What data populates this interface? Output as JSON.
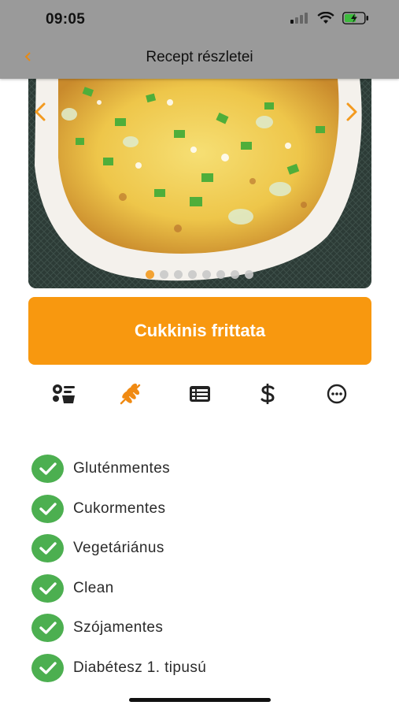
{
  "status_bar": {
    "time": "09:05"
  },
  "header": {
    "title": "Recept részletei"
  },
  "carousel": {
    "total_images": 8,
    "active_index": 0
  },
  "recipe": {
    "title": "Cukkinis frittata"
  },
  "tabs": [
    {
      "icon": "ingredients-scale-icon",
      "active": false
    },
    {
      "icon": "wheat-icon",
      "active": true
    },
    {
      "icon": "list-table-icon",
      "active": false
    },
    {
      "icon": "dollar-icon",
      "active": false
    },
    {
      "icon": "more-circle-icon",
      "active": false
    }
  ],
  "diet_tags": [
    {
      "label": "Gluténmentes"
    },
    {
      "label": "Cukormentes"
    },
    {
      "label": "Vegetáriánus"
    },
    {
      "label": "Clean"
    },
    {
      "label": "Szójamentes"
    },
    {
      "label": "Diabétesz 1. tipusú"
    }
  ],
  "colors": {
    "accent": "#f8980f",
    "check": "#4caf50",
    "topbar": "#9a9a9a"
  }
}
